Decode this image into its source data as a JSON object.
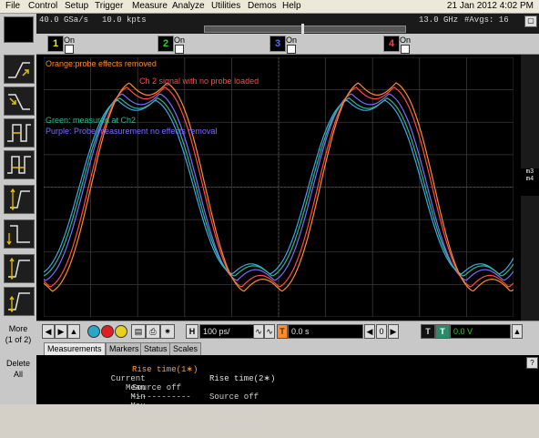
{
  "menubar": {
    "items": [
      "File",
      "Control",
      "Setup",
      "Trigger",
      "Measure",
      "Analyze",
      "Utilities",
      "Demos",
      "Help"
    ],
    "datetime": "21 Jan 2012  4:02 PM"
  },
  "status": {
    "sample_rate": "40.0 GSa/s",
    "memory": "10.0 kpts",
    "bandwidth": "13.0 GHz",
    "averages": "#Avgs: 16"
  },
  "channels": [
    {
      "label": "1",
      "state": "On",
      "color": "#e8e800"
    },
    {
      "label": "2",
      "state": "On",
      "color": "#30d030"
    },
    {
      "label": "3",
      "state": "On",
      "color": "#5070ff"
    },
    {
      "label": "4",
      "state": "On",
      "color": "#ff4040"
    }
  ],
  "annotations": {
    "orange": "Orange:probe effects removed",
    "ch2": "Ch 2 signal with no probe loaded",
    "green": "Green: measured at Ch2",
    "purple": "Purple: Probe measurement no effects removal"
  },
  "right_marker": {
    "line1": "m3",
    "line2": "m4"
  },
  "trace_colors": {
    "orange": "#ff8c2a",
    "red": "#ff4a4a",
    "green": "#2fb88a",
    "purple": "#7a6cff",
    "cyan": "#3ea8e8"
  },
  "left_panel": {
    "more_label": "More",
    "more_sub": "(1 of 2)",
    "delete_label": "Delete",
    "delete_sub": "All"
  },
  "controls": {
    "h_label": "H",
    "timebase": "100 ps/",
    "t_label": "T",
    "delay": "0.0 s",
    "trigger_level": "0.0 V"
  },
  "tabs": [
    "Measurements",
    "Markers",
    "Status",
    "Scales"
  ],
  "measurements": {
    "col1_header": "Rise time(1∗)",
    "col2_header": "Rise time(2∗)",
    "rows": [
      {
        "label": "Current",
        "v1": "Source off",
        "v2": "Source off"
      },
      {
        "label": "Mean",
        "v1": "------------",
        "v2": "------------"
      },
      {
        "label": "Min",
        "v1": "------------",
        "v2": "------------"
      },
      {
        "label": "Max",
        "v1": "------------",
        "v2": "------------"
      }
    ],
    "help": "?"
  }
}
